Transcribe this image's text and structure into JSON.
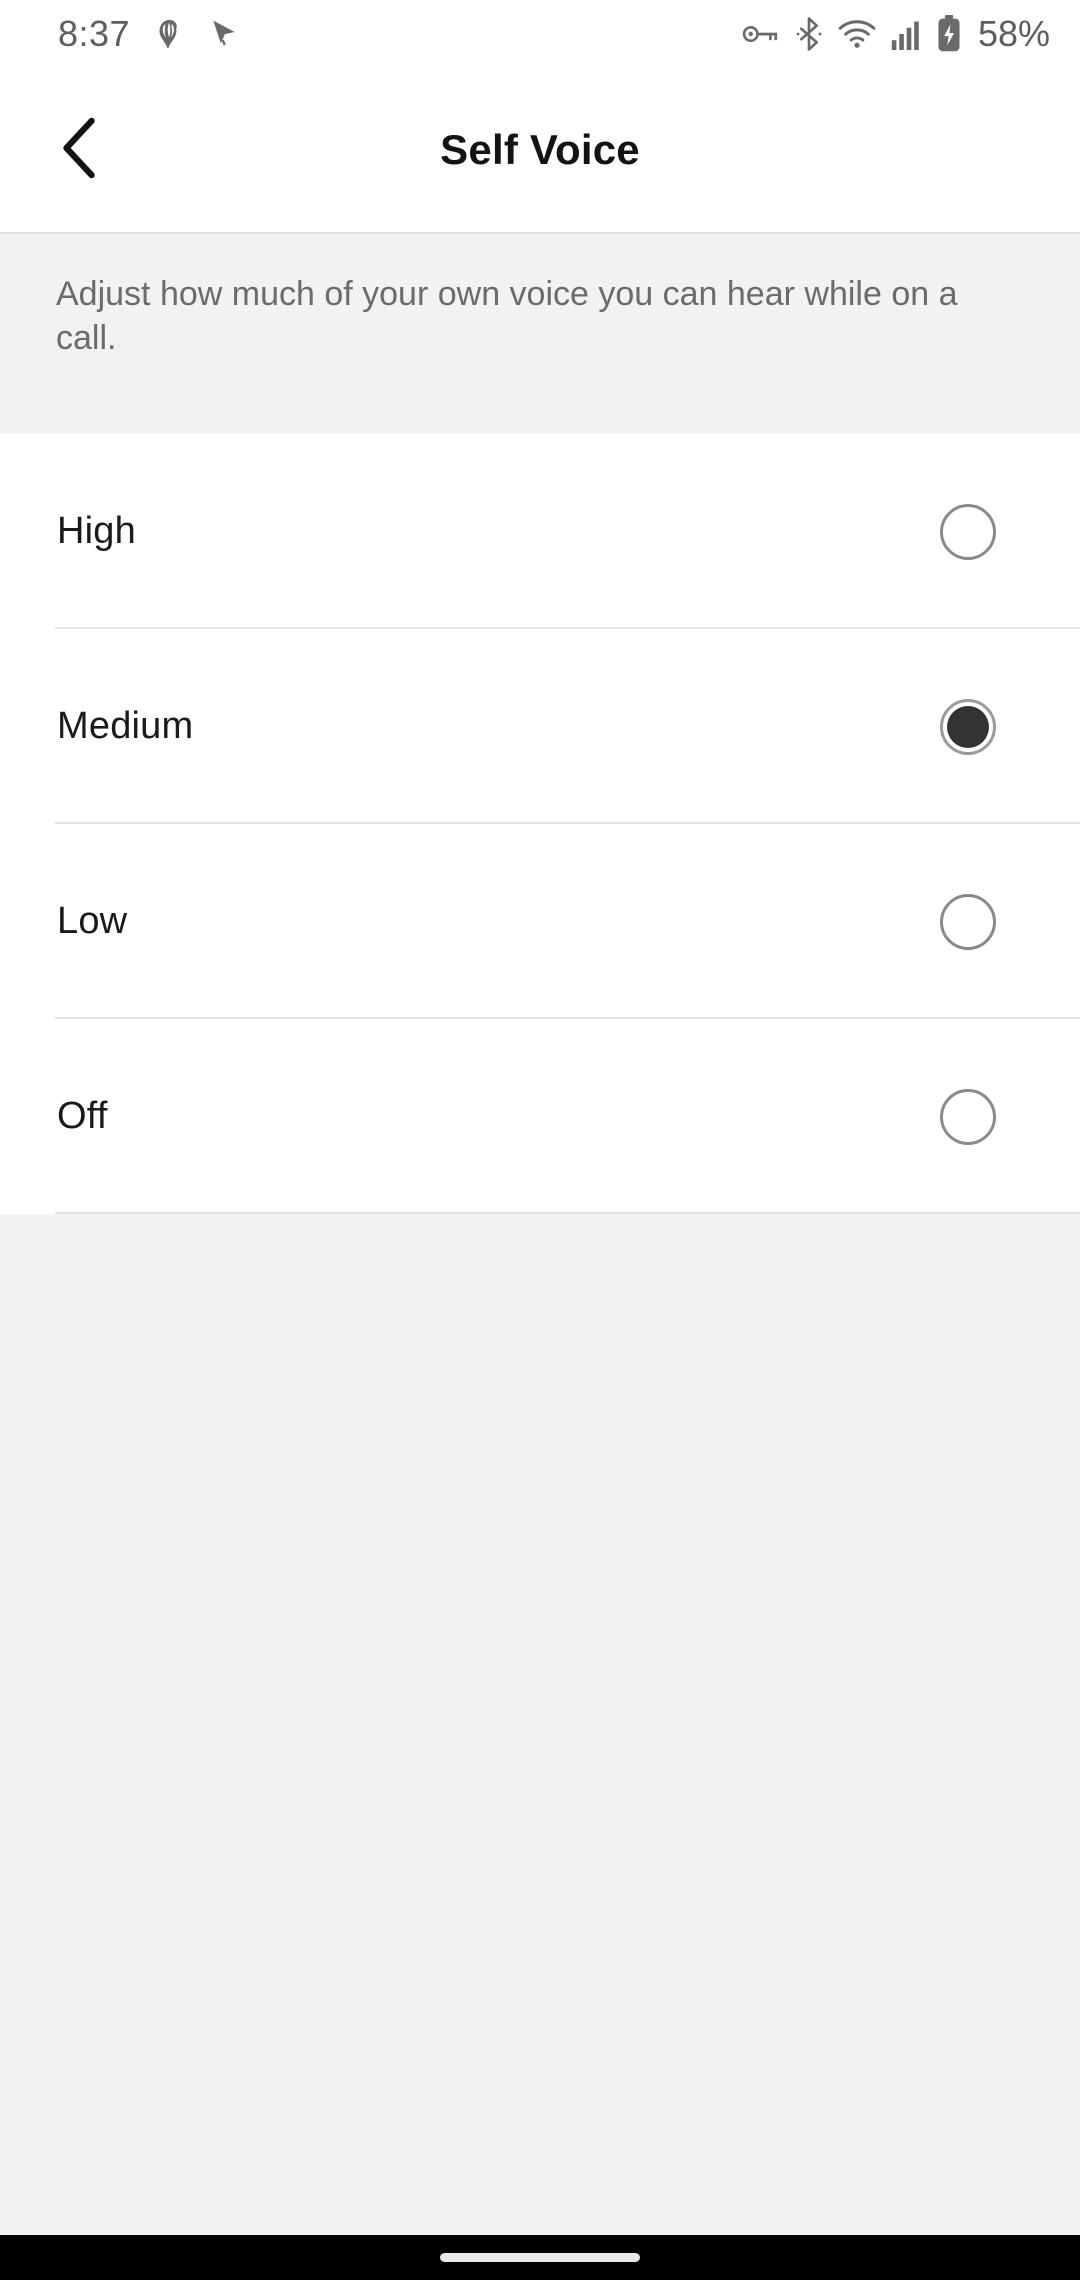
{
  "status_bar": {
    "time": "8:37",
    "battery_percent": "58%",
    "left_icons": [
      {
        "name": "magisk-icon"
      },
      {
        "name": "cursor-pointer-icon"
      }
    ],
    "right_icons": [
      {
        "name": "vpn-key-icon"
      },
      {
        "name": "bluetooth-icon"
      },
      {
        "name": "wifi-icon"
      },
      {
        "name": "cellular-signal-icon"
      },
      {
        "name": "battery-charging-icon"
      }
    ],
    "colors": {
      "text": "#5e5e5e"
    }
  },
  "header": {
    "title": "Self Voice",
    "back_icon": "chevron-left-icon"
  },
  "description": {
    "text": "Adjust how much of your own voice you can hear while on a call."
  },
  "options": {
    "selected": "Medium",
    "items": [
      {
        "label": "High",
        "selected": false
      },
      {
        "label": "Medium",
        "selected": true
      },
      {
        "label": "Low",
        "selected": false
      },
      {
        "label": "Off",
        "selected": false
      }
    ]
  },
  "navigation_bar": {
    "home_indicator": "home-indicator"
  },
  "colors": {
    "page_background": "#f2f2f2",
    "surface": "#ffffff",
    "primary_text": "#1a1a1a",
    "secondary_text": "#6b6b6b",
    "divider": "#e4e4e4",
    "radio_selected_fill": "#333333",
    "radio_border": "#8a8a8a",
    "nav_bar": "#000000"
  }
}
